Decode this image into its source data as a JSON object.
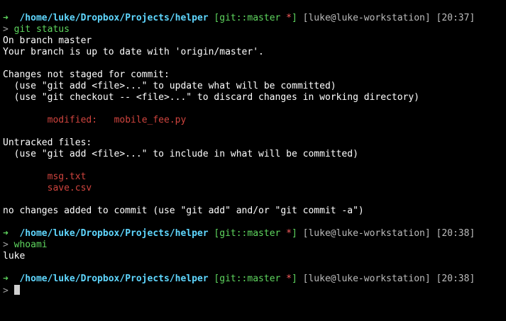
{
  "prompt": {
    "arrow": "➜",
    "path": "/home/luke/Dropbox/Projects/helper",
    "git_prefix": "[git::master",
    "git_dirty": "*",
    "git_suffix": "]",
    "user_host": "[luke@luke-workstation]",
    "input_marker": ">"
  },
  "sessions": [
    {
      "time": "[20:37]",
      "command": "git status",
      "output": {
        "l1": "On branch master",
        "l2": "Your branch is up to date with 'origin/master'.",
        "l3": "Changes not staged for commit:",
        "l4": "  (use \"git add <file>...\" to update what will be committed)",
        "l5": "  (use \"git checkout -- <file>...\" to discard changes in working directory)",
        "modified_label": "modified:",
        "modified_file": "mobile_fee.py",
        "l6": "Untracked files:",
        "l7": "  (use \"git add <file>...\" to include in what will be committed)",
        "untracked": [
          "msg.txt",
          "save.csv"
        ],
        "l8": "no changes added to commit (use \"git add\" and/or \"git commit -a\")"
      }
    },
    {
      "time": "[20:38]",
      "command": "whoami",
      "output": {
        "l1": "luke"
      }
    },
    {
      "time": "[20:38]",
      "command": ""
    }
  ]
}
